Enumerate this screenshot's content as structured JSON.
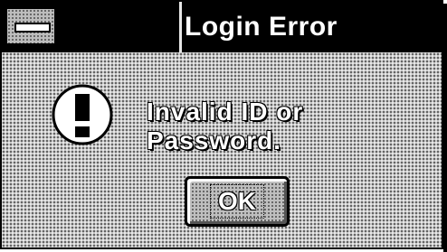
{
  "window": {
    "title": "Login Error"
  },
  "dialog": {
    "icon": "exclamation-icon",
    "message": "Invalid ID or Password.",
    "ok_label": "OK"
  },
  "colors": {
    "titlebar": "#000000",
    "title_text": "#ffffff",
    "dialog_background": "#c8c8c8"
  }
}
